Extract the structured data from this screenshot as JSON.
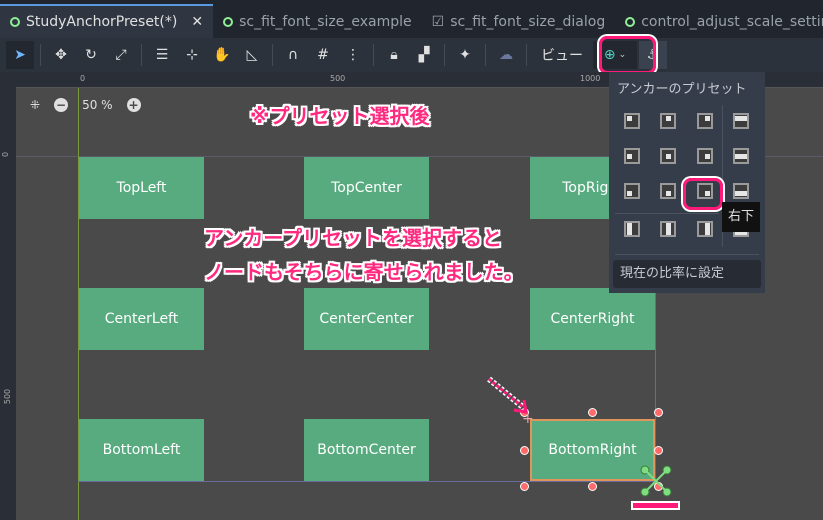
{
  "tabs": [
    {
      "label": "StudyAnchorPreset(*)",
      "active": true,
      "close": "✕"
    },
    {
      "label": "sc_fit_font_size_example"
    },
    {
      "label": "sc_fit_font_size_dialog"
    },
    {
      "label": "control_adjust_scale_setting"
    }
  ],
  "toolbar": {
    "view_label": "ビュー"
  },
  "ruler": {
    "top": [
      "0",
      "500",
      "1000"
    ],
    "left": [
      "0",
      "500"
    ]
  },
  "zoom": {
    "value": "50 %"
  },
  "nodes": [
    "TopLeft",
    "TopCenter",
    "TopRight",
    "CenterLeft",
    "CenterCenter",
    "CenterRight",
    "BottomLeft",
    "BottomCenter",
    "BottomRight"
  ],
  "annotations": {
    "title": "※プリセット選択後",
    "line1": "アンカープリセットを選択すると",
    "line2": "ノードもそちらに寄せられました。"
  },
  "popup": {
    "title": "アンカーのプリセット",
    "tooltip": "右下",
    "set_ratio": "現在の比率に設定"
  },
  "colors": {
    "node": "#57ab7f",
    "highlight": "#ff1a7a"
  }
}
